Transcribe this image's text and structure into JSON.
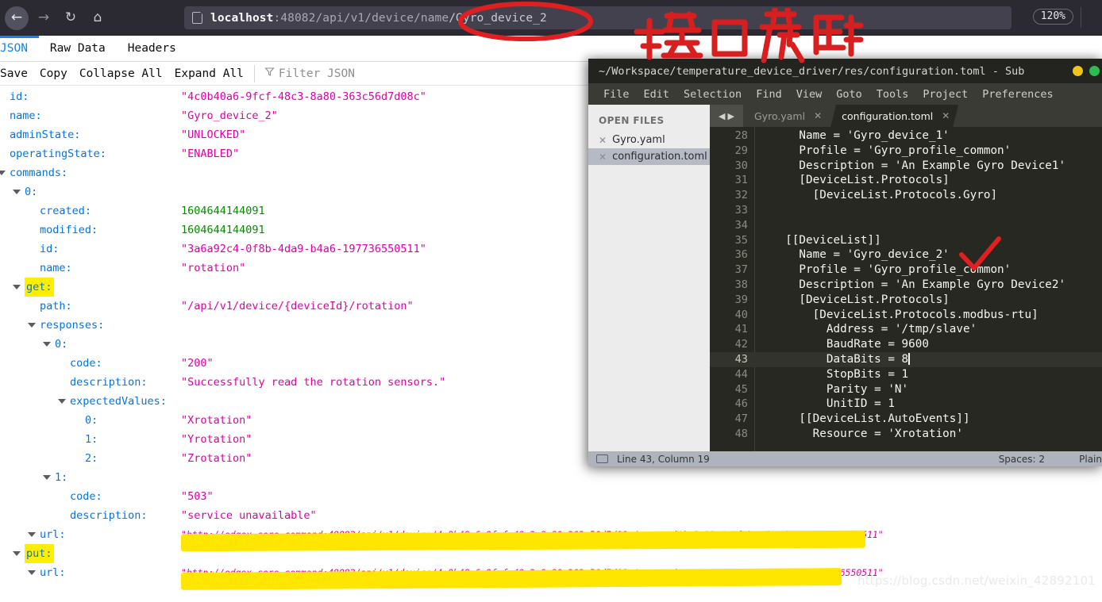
{
  "browser": {
    "back_icon": "arrow-left-icon",
    "forward_icon": "arrow-right-icon",
    "reload_icon": "reload-icon",
    "home_icon": "home-icon",
    "url_host": "localhost",
    "url_port_path": ":48082/api/v1/device/name",
    "url_tail": "/Gyro_device_2",
    "zoom_level": "120%"
  },
  "json_viewer": {
    "tabs": [
      {
        "label": "JSON",
        "active": true
      },
      {
        "label": "Raw Data",
        "active": false
      },
      {
        "label": "Headers",
        "active": false
      }
    ],
    "toolbar": {
      "save": "Save",
      "copy": "Copy",
      "collapse_all": "Collapse All",
      "expand_all": "Expand All",
      "filter_placeholder": "Filter JSON"
    },
    "rows": [
      {
        "key": "id:",
        "indent": 0,
        "twisty": false,
        "value": "\"4c0b40a6-9fcf-48c3-8a80-363c56d7d08c\"",
        "vtype": "str"
      },
      {
        "key": "name:",
        "indent": 0,
        "twisty": false,
        "value": "\"Gyro_device_2\"",
        "vtype": "str"
      },
      {
        "key": "adminState:",
        "indent": 0,
        "twisty": false,
        "value": "\"UNLOCKED\"",
        "vtype": "str"
      },
      {
        "key": "operatingState:",
        "indent": 0,
        "twisty": false,
        "value": "\"ENABLED\"",
        "vtype": "str"
      },
      {
        "key": "commands:",
        "indent": 0,
        "twisty": true,
        "value": "",
        "vtype": "none"
      },
      {
        "key": "0:",
        "indent": 1,
        "twisty": true,
        "value": "",
        "vtype": "none"
      },
      {
        "key": "created:",
        "indent": 2,
        "twisty": false,
        "value": "1604644144091",
        "vtype": "num"
      },
      {
        "key": "modified:",
        "indent": 2,
        "twisty": false,
        "value": "1604644144091",
        "vtype": "num"
      },
      {
        "key": "id:",
        "indent": 2,
        "twisty": false,
        "value": "\"3a6a92c4-0f8b-4da9-b4a6-197736550511\"",
        "vtype": "str"
      },
      {
        "key": "name:",
        "indent": 2,
        "twisty": false,
        "value": "\"rotation\"",
        "vtype": "str"
      },
      {
        "key": "get:",
        "indent": 1,
        "twisty": true,
        "value": "",
        "vtype": "none",
        "highlight": true
      },
      {
        "key": "path:",
        "indent": 2,
        "twisty": false,
        "value": "\"/api/v1/device/{deviceId}/rotation\"",
        "vtype": "str"
      },
      {
        "key": "responses:",
        "indent": 2,
        "twisty": true,
        "value": "",
        "vtype": "none"
      },
      {
        "key": "0:",
        "indent": 3,
        "twisty": true,
        "value": "",
        "vtype": "none"
      },
      {
        "key": "code:",
        "indent": 4,
        "twisty": false,
        "value": "\"200\"",
        "vtype": "str"
      },
      {
        "key": "description:",
        "indent": 4,
        "twisty": false,
        "value": "\"Successfully read the rotation sensors.\"",
        "vtype": "str"
      },
      {
        "key": "expectedValues:",
        "indent": 4,
        "twisty": true,
        "value": "",
        "vtype": "none"
      },
      {
        "key": "0:",
        "indent": 5,
        "twisty": false,
        "value": "\"Xrotation\"",
        "vtype": "str"
      },
      {
        "key": "1:",
        "indent": 5,
        "twisty": false,
        "value": "\"Yrotation\"",
        "vtype": "str"
      },
      {
        "key": "2:",
        "indent": 5,
        "twisty": false,
        "value": "\"Zrotation\"",
        "vtype": "str"
      },
      {
        "key": "1:",
        "indent": 3,
        "twisty": true,
        "value": "",
        "vtype": "none"
      },
      {
        "key": "code:",
        "indent": 4,
        "twisty": false,
        "value": "\"503\"",
        "vtype": "str"
      },
      {
        "key": "description:",
        "indent": 4,
        "twisty": false,
        "value": "\"service unavailable\"",
        "vtype": "str"
      },
      {
        "key": "url:",
        "indent": 2,
        "twisty": true,
        "value": "\"http://edgex-core-command:48082/api/v1/device/4c0b40a6-9fcf-48c3-8a80-363c56d7d08c/command/3a6a92c4-0f8b-4da9-b4a6-197736550511\"",
        "vtype": "url"
      },
      {
        "key": "put:",
        "indent": 1,
        "twisty": true,
        "value": "",
        "vtype": "none",
        "highlight": true
      },
      {
        "key": "url:",
        "indent": 2,
        "twisty": true,
        "value": "\"http://edgex-core-command:48082/api/v1/device/4c0b40a6-9fcf-48c3-8a80-363c56d7d08c/command/3a6a92c4-0f8b-4da9-b4a6-197736550511\"",
        "vtype": "url"
      }
    ]
  },
  "sublime": {
    "title": "~/Workspace/temperature_device_driver/res/configuration.toml - Sub",
    "menu": [
      "File",
      "Edit",
      "Selection",
      "Find",
      "View",
      "Goto",
      "Tools",
      "Project",
      "Preferences"
    ],
    "sidebar": {
      "header": "OPEN FILES",
      "files": [
        {
          "name": "Gyro.yaml",
          "selected": false
        },
        {
          "name": "configuration.toml",
          "selected": true
        }
      ]
    },
    "tabs": [
      {
        "label": "Gyro.yaml",
        "active": false
      },
      {
        "label": "configuration.toml",
        "active": true
      }
    ],
    "code_lines": [
      {
        "no": "28",
        "text": "    Name = 'Gyro_device_1'"
      },
      {
        "no": "29",
        "text": "    Profile = 'Gyro_profile_common'"
      },
      {
        "no": "30",
        "text": "    Description = 'An Example Gyro Device1'"
      },
      {
        "no": "31",
        "text": "    [DeviceList.Protocols]"
      },
      {
        "no": "32",
        "text": "      [DeviceList.Protocols.Gyro]"
      },
      {
        "no": "33",
        "text": ""
      },
      {
        "no": "34",
        "text": ""
      },
      {
        "no": "35",
        "text": "  [[DeviceList]]"
      },
      {
        "no": "36",
        "text": "    Name = 'Gyro_device_2'"
      },
      {
        "no": "37",
        "text": "    Profile = 'Gyro_profile_common'"
      },
      {
        "no": "38",
        "text": "    Description = 'An Example Gyro Device2'"
      },
      {
        "no": "39",
        "text": "    [DeviceList.Protocols]"
      },
      {
        "no": "40",
        "text": "      [DeviceList.Protocols.modbus-rtu]"
      },
      {
        "no": "41",
        "text": "        Address = '/tmp/slave'"
      },
      {
        "no": "42",
        "text": "        BaudRate = 9600"
      },
      {
        "no": "43",
        "text": "        DataBits = 8",
        "current": true,
        "cursor": true
      },
      {
        "no": "44",
        "text": "        StopBits = 1"
      },
      {
        "no": "45",
        "text": "        Parity = 'N'"
      },
      {
        "no": "46",
        "text": "        UnitID = 1"
      },
      {
        "no": "47",
        "text": "    [[DeviceList.AutoEvents]]"
      },
      {
        "no": "48",
        "text": "      Resource = 'Xrotation'"
      }
    ],
    "status": {
      "position": "Line 43, Column 19",
      "spaces": "Spaces: 2",
      "syntax": "Plain"
    }
  },
  "annotations": {
    "handwritten_note": "接口获取",
    "url_circle": "red-ellipse-annotation",
    "checkmark": "red-check-annotation",
    "highlight_color": "#ffe600",
    "ink_color": "#e02020"
  },
  "watermark": "https://blog.csdn.net/weixin_42892101"
}
